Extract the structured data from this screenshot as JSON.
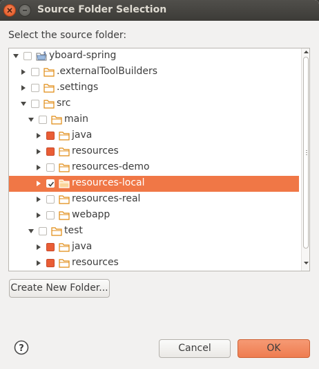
{
  "window": {
    "title": "Source Folder Selection",
    "close_icon": "close-icon",
    "minimize_icon": "minimize-icon"
  },
  "prompt": "Select the source folder:",
  "tree": {
    "items": [
      {
        "label": "yboard-spring",
        "depth": 0,
        "expanded": true,
        "check": "unchecked",
        "icon": "project-icon",
        "selected": false
      },
      {
        "label": ".externalToolBuilders",
        "depth": 1,
        "expanded": false,
        "check": "unchecked",
        "icon": "folder-icon",
        "selected": false
      },
      {
        "label": ".settings",
        "depth": 1,
        "expanded": false,
        "check": "unchecked",
        "icon": "folder-icon",
        "selected": false
      },
      {
        "label": "src",
        "depth": 1,
        "expanded": true,
        "check": "unchecked",
        "icon": "folder-icon",
        "selected": false
      },
      {
        "label": "main",
        "depth": 2,
        "expanded": true,
        "check": "unchecked",
        "icon": "folder-icon",
        "selected": false
      },
      {
        "label": "java",
        "depth": 3,
        "expanded": false,
        "check": "partial",
        "icon": "folder-icon",
        "selected": false
      },
      {
        "label": "resources",
        "depth": 3,
        "expanded": false,
        "check": "partial",
        "icon": "folder-icon",
        "selected": false
      },
      {
        "label": "resources-demo",
        "depth": 3,
        "expanded": false,
        "check": "unchecked",
        "icon": "folder-icon",
        "selected": false
      },
      {
        "label": "resources-local",
        "depth": 3,
        "expanded": false,
        "check": "checked",
        "icon": "folder-icon",
        "selected": true
      },
      {
        "label": "resources-real",
        "depth": 3,
        "expanded": false,
        "check": "unchecked",
        "icon": "folder-icon",
        "selected": false
      },
      {
        "label": "webapp",
        "depth": 3,
        "expanded": false,
        "check": "unchecked",
        "icon": "folder-icon",
        "selected": false
      },
      {
        "label": "test",
        "depth": 2,
        "expanded": true,
        "check": "unchecked",
        "icon": "folder-icon",
        "selected": false
      },
      {
        "label": "java",
        "depth": 3,
        "expanded": false,
        "check": "partial",
        "icon": "folder-icon",
        "selected": false
      },
      {
        "label": "resources",
        "depth": 3,
        "expanded": false,
        "check": "partial",
        "icon": "folder-icon",
        "selected": false
      }
    ]
  },
  "buttons": {
    "create_new_folder": "Create New Folder...",
    "cancel": "Cancel",
    "ok": "OK",
    "help_icon": "help-icon"
  },
  "colors": {
    "accent": "#f07746",
    "partial_check": "#e95d35",
    "folder": "#f5a623"
  }
}
